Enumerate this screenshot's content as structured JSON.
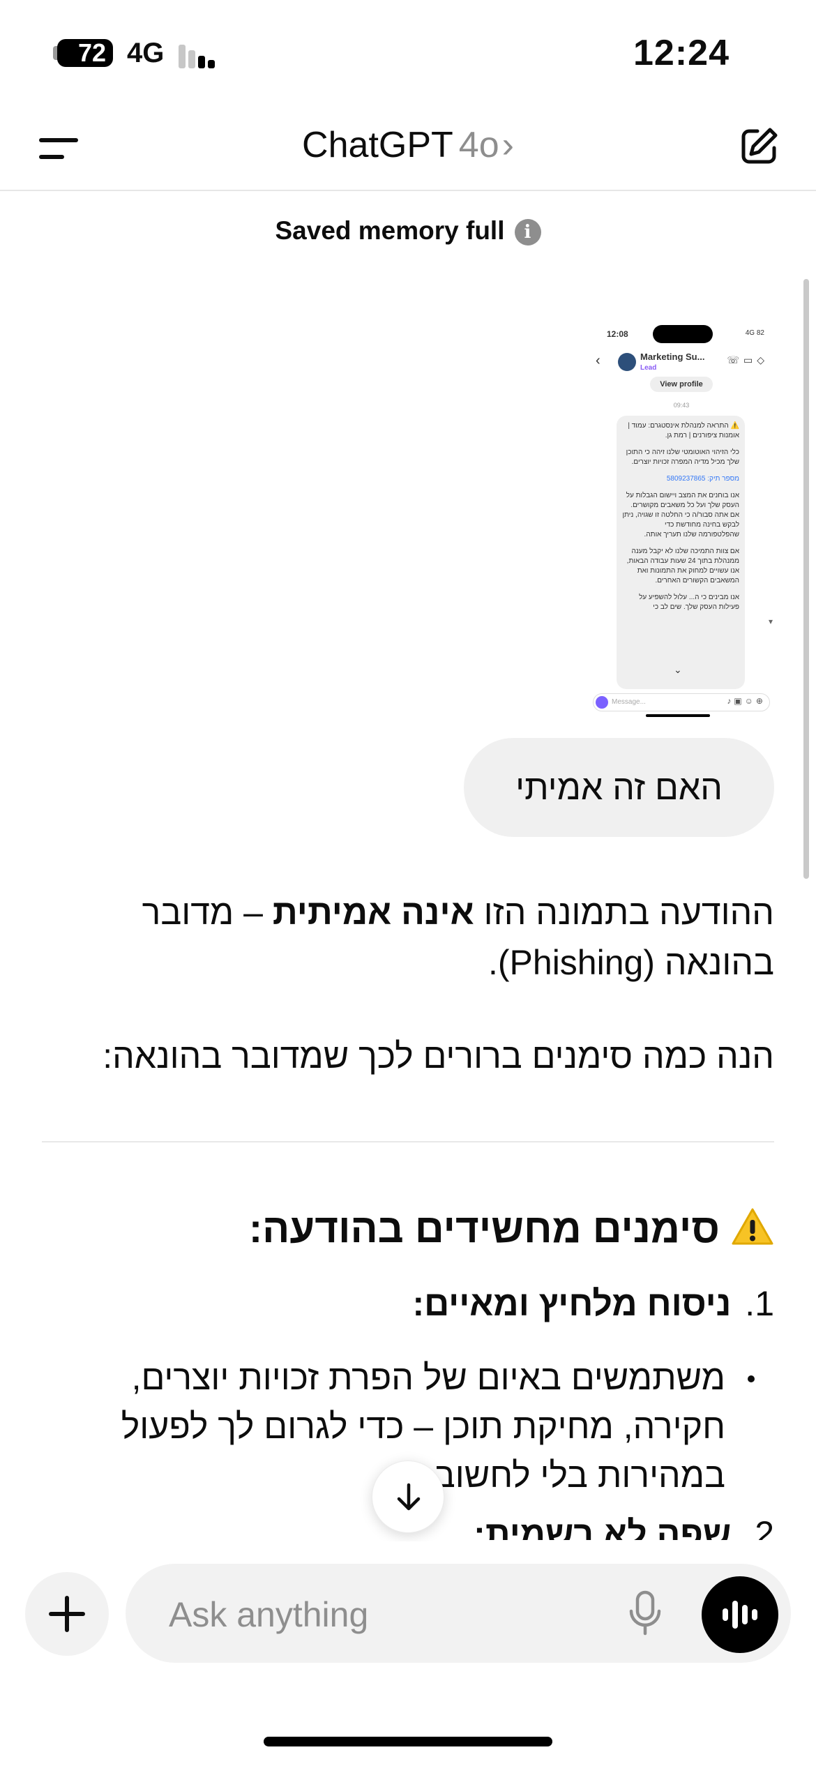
{
  "status_bar": {
    "battery": "72",
    "network": "4G",
    "time": "12:24"
  },
  "header": {
    "title": "ChatGPT",
    "model": "4o",
    "chevron": "›",
    "menu_icon": "menu-icon",
    "new_chat_icon": "compose-icon"
  },
  "memory_notice": {
    "text": "Saved memory full",
    "info_icon": "i"
  },
  "attached_image": {
    "time": "12:08",
    "status_right": "4G 82",
    "contact_name": "Marketing Su...",
    "contact_tag": "Lead",
    "view_profile": "View profile",
    "timestamp": "09:43",
    "message_lines": [
      "⚠️ התראה למנהלת אינסטגרם: עמוד | אומנות ציפורנים | רמת גן.",
      "כלי הזיהוי האוטומטי שלנו זיהה כי התוכן שלך מכיל מדיה המפרה זכויות יוצרים.",
      "מספר תיק: 5809237865",
      "אנו בוחנים את המצב ויישום הגבלות על העסק שלך ועל כל משאבים מקושרים. אם אתה סבור/ה כי החלטה זו שגויה, ניתן לבקש בחינה מחודשת כדי שהפלטפורמה שלנו תעריך אותה.",
      "אם צוות התמיכה שלנו לא יקבל מענה ממנהלת בתוך 24 שעות עבודה הבאות, אנו עשויים למחוק את התמונות ואת המשאבים הקשורים האחרים.",
      "אנו מבינים כי ה... עלול להשפיע על פעילות העסק שלך. שים לב כי"
    ],
    "case_number": "5809237865",
    "input_placeholder": "Message..."
  },
  "user_message": "האם זה אמיתי",
  "assistant": {
    "para1_before": "ההודעה בתמונה הזו ",
    "para1_bold": "אינה אמיתית",
    "para1_after": " – מדובר בהונאה (Phishing).",
    "para2": "הנה כמה סימנים ברורים לכך שמדובר בהונאה:",
    "heading_icon": "warning-icon",
    "heading": "סימנים מחשידים בהודעה:",
    "items": [
      {
        "number": "1.",
        "title": "ניסוח מלחיץ ומאיים:",
        "bullet": "משתמשים באיום של הפרת זכויות יוצרים, חקירה, מחיקת תוכן – כדי לגרום לך לפעול במהירות בלי לחשוב."
      },
      {
        "number": "2.",
        "title": "שפה לא רשמית:"
      }
    ]
  },
  "composer": {
    "placeholder": "Ask anything",
    "plus_icon": "plus-icon",
    "mic_icon": "microphone-icon",
    "voice_icon": "voice-mode-icon"
  },
  "scroll_down_icon": "arrow-down-icon"
}
